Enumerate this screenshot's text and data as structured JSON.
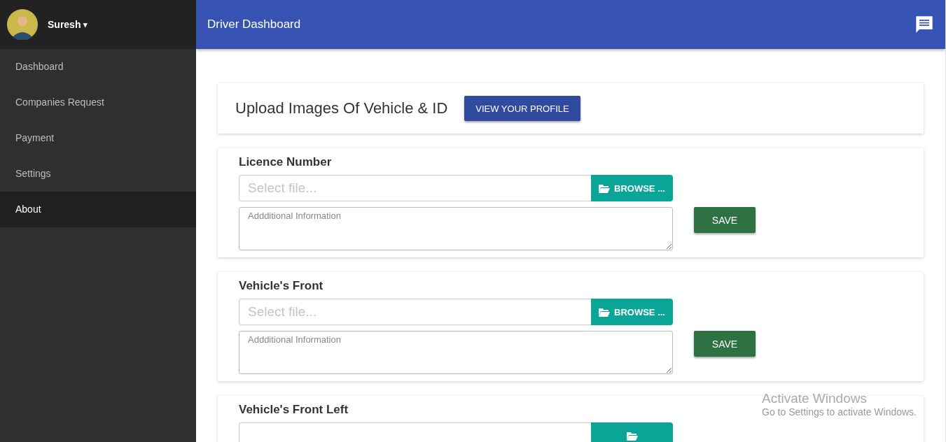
{
  "sidebar": {
    "user": {
      "name": "Suresh",
      "caret": "▾"
    },
    "items": [
      {
        "label": "Dashboard",
        "selected": false
      },
      {
        "label": "Companies Request",
        "selected": false
      },
      {
        "label": "Payment",
        "selected": false
      },
      {
        "label": "Settings",
        "selected": false
      },
      {
        "label": "About",
        "selected": true
      }
    ]
  },
  "header": {
    "title": "Driver Dashboard"
  },
  "intro": {
    "title": "Upload Images Of Vehicle & ID",
    "button": "VIEW YOUR PROFILE"
  },
  "uploads": [
    {
      "title": "Licence Number",
      "placeholder": "Select file...",
      "browse": "BROWSE ...",
      "info_placeholder": "Addditional Information",
      "save": "SAVE"
    },
    {
      "title": "Vehicle's Front",
      "placeholder": "Select file...",
      "browse": "BROWSE ...",
      "info_placeholder": "Addditional Information",
      "save": "SAVE"
    },
    {
      "title": "Vehicle's Front Left"
    }
  ],
  "os_notice": {
    "title": "Activate Windows",
    "text": "Go to Settings to activate Windows."
  }
}
